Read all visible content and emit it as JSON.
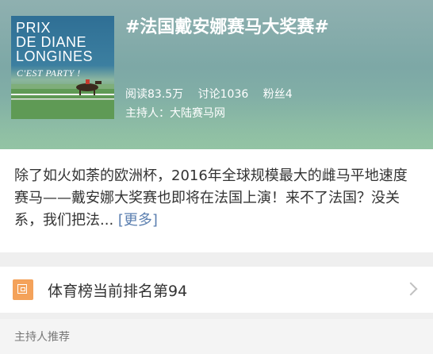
{
  "topic": {
    "cover": {
      "brand_lines": [
        "PRIX",
        "DE DIANE",
        "LONGINES"
      ],
      "tagline": "C'EST PARTY !"
    },
    "title": "#法国戴安娜赛马大奖赛#",
    "stats": {
      "reads": "阅读83.5万",
      "discussions": "讨论1036",
      "fans": "粉丝4"
    },
    "host": "主持人：大陆赛马网"
  },
  "description": {
    "text": "除了如火如荼的欧洲杯，2016年全球规模最大的雌马平地速度赛马——戴安娜大奖赛也即将在法国上演！来不了法国？没关系，我们把法...",
    "more_label": "[更多]"
  },
  "ranking": {
    "icon": "ranking-icon",
    "text": "体育榜当前排名第94"
  },
  "section": {
    "label": "主持人推荐"
  }
}
